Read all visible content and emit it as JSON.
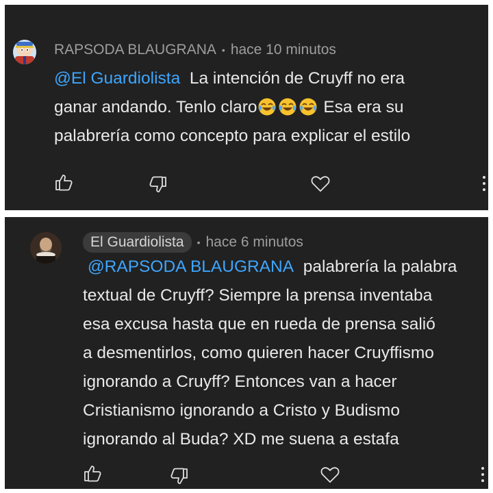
{
  "comments": [
    {
      "author": "RAPSODA BLAUGRANA",
      "separator": "•",
      "time": "hace 10 minutos",
      "mention": "@El Guardiolista",
      "lines": [
        "La intención de Cruyff no era",
        "ganar andando. Tenlo claro",
        "Esa era su",
        "palabrería como concepto para explicar el estilo"
      ],
      "emoji": [
        "face-with-tears-of-joy-emoji",
        "face-with-tears-of-joy-emoji",
        "face-with-tears-of-joy-emoji"
      ],
      "icons": {
        "like": "thumbs-up-icon",
        "dislike": "thumbs-down-icon",
        "heart": "heart-icon",
        "more": "more-vertical-icon"
      }
    },
    {
      "author": "El Guardiolista",
      "separator": "•",
      "time": "hace 6 minutos",
      "mention": "@RAPSODA BLAUGRANA",
      "lines": [
        "palabrería la palabra",
        "textual de Cruyff? Siempre la prensa inventaba",
        "esa excusa hasta que en rueda de prensa salió",
        "a desmentirlos, como quieren hacer Cruyffismo",
        "ignorando a Cruyff? Entonces van a hacer",
        "Cristianismo ignorando a Cristo y Budismo",
        "ignorando al Buda? XD me suena a estafa"
      ],
      "icons": {
        "like": "thumbs-up-icon",
        "dislike": "thumbs-down-icon",
        "heart": "heart-icon",
        "more": "more-vertical-icon"
      }
    }
  ],
  "colors": {
    "background": "#212121",
    "text": "#e9e9e9",
    "meta": "#9e9e9e",
    "mention": "#3ea6ff",
    "chip": "#3b3b3b"
  }
}
